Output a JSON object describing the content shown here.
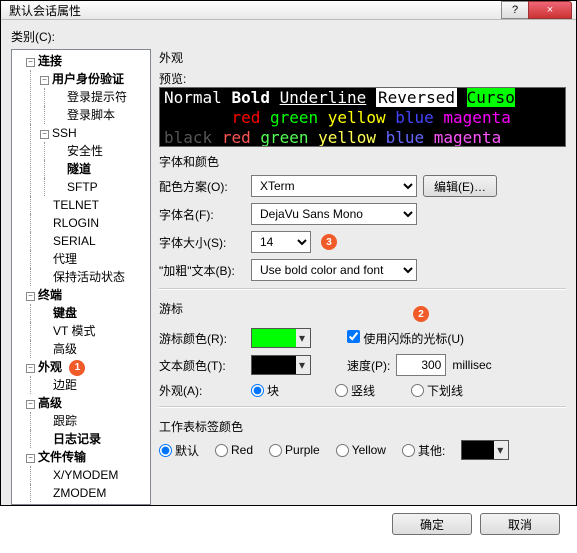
{
  "window": {
    "title": "默认会话属性",
    "help": "?",
    "close": "×"
  },
  "category_label": "类别(C):",
  "tree": {
    "connect": "连接",
    "auth": "用户身份验证",
    "login_prompt": "登录提示符",
    "login_script": "登录脚本",
    "ssh": "SSH",
    "security": "安全性",
    "tunnel": "隧道",
    "sftp": "SFTP",
    "telnet": "TELNET",
    "rlogin": "RLOGIN",
    "serial": "SERIAL",
    "proxy": "代理",
    "keepalive": "保持活动状态",
    "terminal": "终端",
    "keyboard": "键盘",
    "vtmode": "VT 模式",
    "advanced_t": "高级",
    "appearance": "外观",
    "margin": "边距",
    "advanced": "高级",
    "trace": "跟踪",
    "logging": "日志记录",
    "file_transfer": "文件传输",
    "xymodem": "X/YMODEM",
    "zmodem": "ZMODEM"
  },
  "right_title": "外观",
  "preview_label": "预览:",
  "preview": {
    "normal": "Normal",
    "bold": "Bold",
    "underline": "Underline",
    "reversed": "Reversed",
    "cursor": "Curso",
    "red": "red",
    "green": "green",
    "yellow": "yellow",
    "blue": "blue",
    "magenta": "magenta",
    "black": "black"
  },
  "font_colors_label": "字体和颜色",
  "scheme_label": "配色方案(O):",
  "scheme_value": "XTerm",
  "edit_btn": "编辑(E)…",
  "fontname_label": "字体名(F):",
  "fontname_value": "DejaVu Sans Mono",
  "fontsize_label": "字体大小(S):",
  "fontsize_value": "14",
  "boldtext_label": "\"加粗\"文本(B):",
  "boldtext_value": "Use bold color and font",
  "cursor_label": "游标",
  "cursor_color_label": "游标颜色(R):",
  "cursor_color": "#00ff00",
  "blink_label": "使用闪烁的光标(U)",
  "text_color_label": "文本颜色(T):",
  "text_color": "#000000",
  "speed_label": "速度(P):",
  "speed_value": "300",
  "speed_unit": "millisec",
  "appearance_shape_label": "外观(A):",
  "shape_block": "块",
  "shape_vbar": "竖线",
  "shape_underline": "下划线",
  "tab_color_label": "工作表标签颜色",
  "tab_default": "默认",
  "tab_red": "Red",
  "tab_purple": "Purple",
  "tab_yellow": "Yellow",
  "tab_other": "其他:",
  "tab_other_color": "#000000",
  "annot": {
    "one": "1",
    "two": "2",
    "three": "3"
  },
  "buttons": {
    "ok": "确定",
    "cancel": "取消"
  }
}
